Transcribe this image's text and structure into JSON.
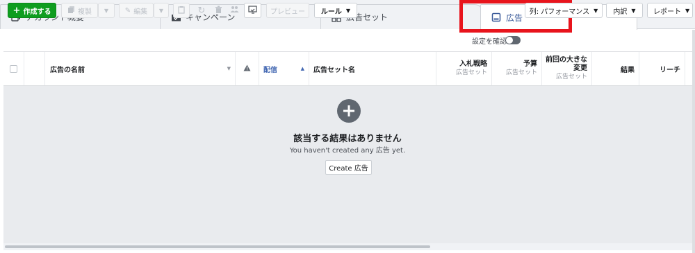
{
  "tabs": [
    {
      "label": "アカウント概要",
      "icon": "account-overview-icon"
    },
    {
      "label": "キャンペーン",
      "icon": "campaign-folder-icon"
    },
    {
      "label": "広告セット",
      "icon": "ad-set-grid-icon"
    },
    {
      "label": "広告",
      "icon": "ad-icon",
      "active": true
    }
  ],
  "toolbar": {
    "create_label": "作成する",
    "duplicate_label": "複製",
    "edit_label": "編集",
    "preview_label": "プレビュー",
    "rules_label": "ルール",
    "view_settings_label": "設定を確認",
    "columns_label": "列: パフォーマンス",
    "breakdown_label": "内訳",
    "reports_label": "レポート"
  },
  "table": {
    "columns": [
      {
        "key": "ad_name",
        "label": "広告の名前"
      },
      {
        "key": "warning",
        "label": ""
      },
      {
        "key": "delivery",
        "label": "配信"
      },
      {
        "key": "ad_set_name",
        "label": "広告セット名"
      },
      {
        "key": "bid_strategy",
        "label": "入札戦略",
        "sub": "広告セット"
      },
      {
        "key": "budget",
        "label": "予算",
        "sub": "広告セット"
      },
      {
        "key": "last_significant_edit",
        "label": "前回の大きな変更",
        "label_line1": "前回の大きな",
        "label_line2": "変更",
        "sub": "広告セット"
      },
      {
        "key": "results",
        "label": "結果"
      },
      {
        "key": "reach",
        "label": "リーチ"
      }
    ]
  },
  "empty_state": {
    "title": "該当する結果はありません",
    "subtitle": "You haven't created any 広告 yet.",
    "create_button": "Create 広告"
  },
  "colors": {
    "create_green": "#0f9d1f",
    "highlight_red": "#e8141c",
    "link_blue": "#4267b2"
  }
}
